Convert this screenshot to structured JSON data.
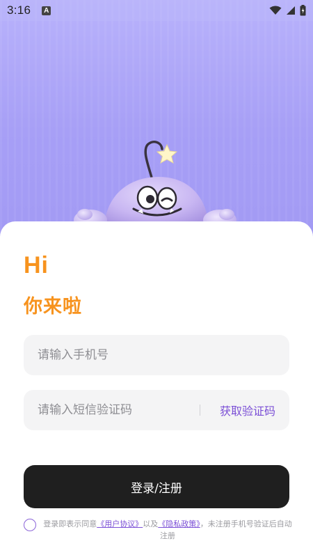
{
  "status_bar": {
    "time": "3:16",
    "notification_letter": "A"
  },
  "greeting": {
    "title": "Hi",
    "subtitle": "你来啦"
  },
  "phone_field": {
    "placeholder": "请输入手机号",
    "value": ""
  },
  "code_field": {
    "placeholder": "请输入短信验证码",
    "value": "",
    "get_code_label": "获取验证码"
  },
  "login_button": {
    "label": "登录/注册"
  },
  "agreement": {
    "checked": false,
    "prefix": "登录即表示同意",
    "user_agreement": "《用户协议》",
    "connector": "以及",
    "privacy_policy": "《隐私政策》",
    "suffix": "，未注册手机号验证后自动注册"
  },
  "colors": {
    "accent": "#f7931e",
    "link": "#7b4fd6",
    "button": "#1f1f1f",
    "hero_bg": "#a9a3f6"
  },
  "icons": [
    "wifi-icon",
    "signal-icon",
    "battery-icon",
    "mascot-illustration"
  ]
}
